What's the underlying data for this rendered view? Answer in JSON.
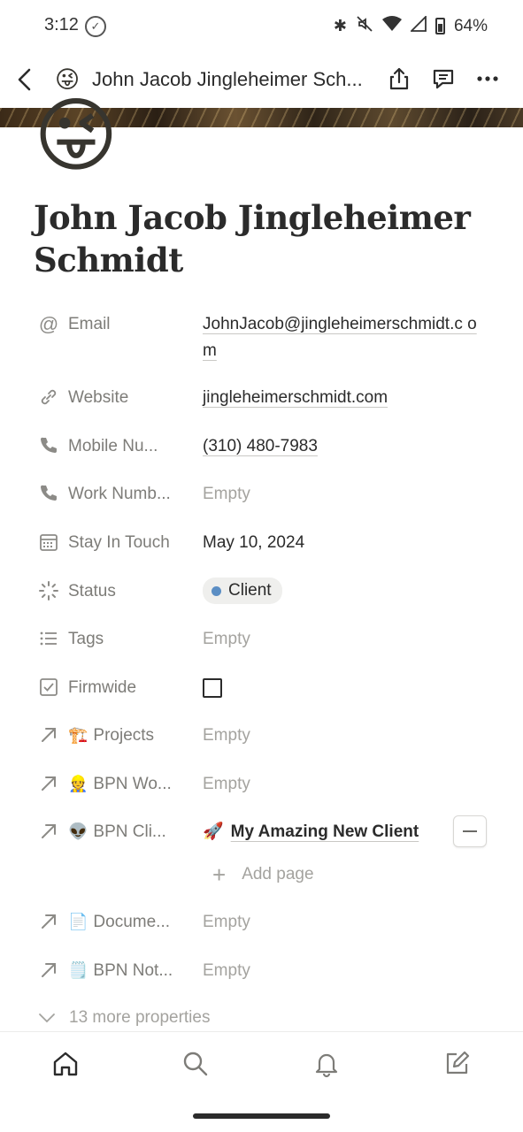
{
  "status_bar": {
    "time": "3:12",
    "battery": "64%",
    "icons": [
      "check-circle-icon",
      "bluetooth-icon",
      "mute-icon",
      "wifi-icon",
      "signal-icon",
      "battery-icon"
    ]
  },
  "topnav": {
    "emoji": "😜",
    "title": "John Jacob Jingleheimer Sch...",
    "icons": [
      "back-icon",
      "share-icon",
      "comment-icon",
      "more-icon"
    ]
  },
  "page": {
    "icon": "😜",
    "title": "John Jacob Jingleheimer Schmidt"
  },
  "properties": [
    {
      "icon": "at-icon",
      "label": "Email",
      "value": "JohnJacob@jingleheimerschmidt.c om",
      "type": "link"
    },
    {
      "icon": "link-icon",
      "label": "Website",
      "value": "jingleheimerschmidt.com",
      "type": "link"
    },
    {
      "icon": "phone-icon",
      "label": "Mobile Nu...",
      "value": "(310) 480-7983",
      "type": "link"
    },
    {
      "icon": "phone-icon",
      "label": "Work Numb...",
      "value": "Empty",
      "type": "empty"
    },
    {
      "icon": "calendar-icon",
      "label": "Stay In Touch",
      "value": "May 10, 2024",
      "type": "text"
    },
    {
      "icon": "status-icon",
      "label": "Status",
      "value": "Client",
      "type": "status"
    },
    {
      "icon": "list-icon",
      "label": "Tags",
      "value": "Empty",
      "type": "empty"
    },
    {
      "icon": "checkbox-icon",
      "label": "Firmwide",
      "value": "",
      "type": "checkbox"
    },
    {
      "icon": "arrow-icon",
      "label_emoji": "🏗️",
      "label": "Projects",
      "value": "Empty",
      "type": "empty"
    },
    {
      "icon": "arrow-icon",
      "label_emoji": "👷",
      "label": "BPN Wo...",
      "value": "Empty",
      "type": "empty"
    },
    {
      "icon": "arrow-icon",
      "label_emoji": "👽",
      "label": "BPN Cli...",
      "value": "My Amazing New Client",
      "value_emoji": "🚀",
      "type": "relation",
      "add_page": "Add page"
    },
    {
      "icon": "arrow-icon",
      "label_emoji": "📄",
      "label": "Docume...",
      "value": "Empty",
      "type": "empty"
    },
    {
      "icon": "arrow-icon",
      "label_emoji": "🗒️",
      "label": "BPN Not...",
      "value": "Empty",
      "type": "empty"
    }
  ],
  "more_properties": "13 more properties",
  "bottom_nav": [
    "home-icon",
    "search-icon",
    "bell-icon",
    "compose-icon"
  ],
  "colors": {
    "status_dot": "#5b8ec4",
    "text": "#37352f",
    "muted": "#a4a39f"
  }
}
